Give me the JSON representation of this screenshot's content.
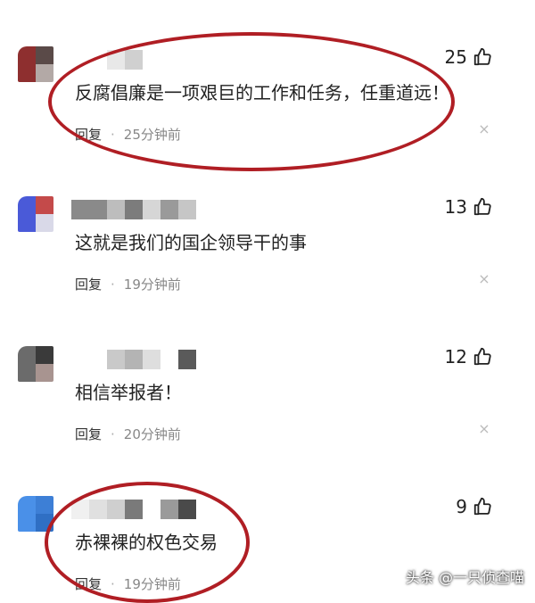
{
  "comments": [
    {
      "text": "反腐倡廉是一项艰巨的工作和任务，任重道远！",
      "likes": "25",
      "reply_label": "回复",
      "separator": "·",
      "time": "25分钟前"
    },
    {
      "text": "这就是我们的国企领导干的事",
      "likes": "13",
      "reply_label": "回复",
      "separator": "·",
      "time": "19分钟前"
    },
    {
      "text": "相信举报者！",
      "likes": "12",
      "reply_label": "回复",
      "separator": "·",
      "time": "20分钟前"
    },
    {
      "text": "赤裸裸的权色交易",
      "likes": "9",
      "reply_label": "回复",
      "separator": "·",
      "time": "19分钟前"
    }
  ],
  "icons": {
    "like": "thumbs-up-icon",
    "close": "close-x-icon"
  },
  "annotation_color": "#b01e24",
  "watermark": {
    "text": "头条 @一只侦查喵"
  }
}
